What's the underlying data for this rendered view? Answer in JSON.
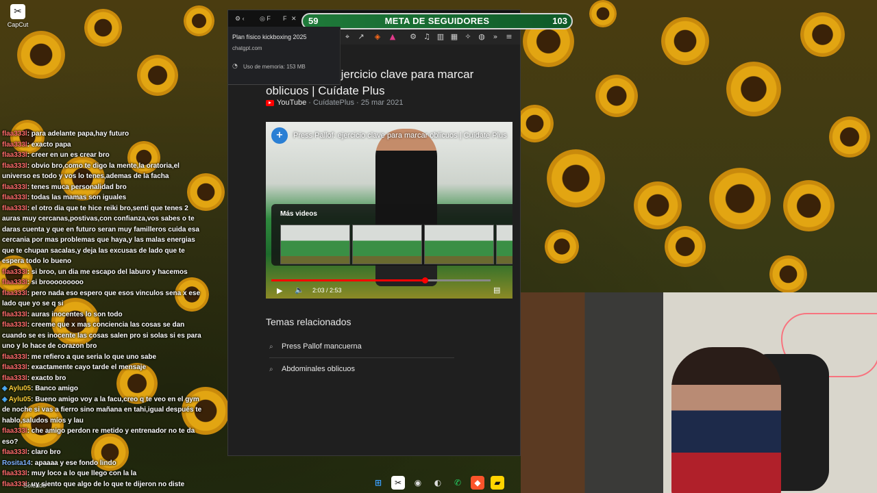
{
  "desktop": {
    "icon_label": "CapCut"
  },
  "browser": {
    "tabs": [
      "Plan físico kickboxing 2025"
    ],
    "tooltip": {
      "title": "Plan físico kickboxing 2025",
      "domain": "chatgpt.com",
      "memory": "Uso de memoria: 153 MB"
    },
    "content": {
      "title": "Press Pallof: ejercicio clave para marcar oblicuos | Cuídate Plus",
      "source": "YouTube",
      "channel": "CuídatePlus",
      "date": "25 mar 2021",
      "video_title": "Press Pallof: ejercicio clave para marcar oblicuos | Cuídate Plus",
      "more_videos": "Más videos",
      "time": "2:03 / 2:53",
      "progress": 0.7,
      "related_heading": "Temas relacionados",
      "related": [
        "Press Pallof mancuerna",
        "Abdominales oblicuos"
      ]
    }
  },
  "goal": {
    "current": "59",
    "label": "META DE SEGUIDORES",
    "target": "103"
  },
  "chat": [
    {
      "user": "flaa333l",
      "text": ": para adelante papa,hay futuro"
    },
    {
      "user": "flaa333l",
      "text": ": exacto papa"
    },
    {
      "user": "flaa333l",
      "text": ": creer en un es crear bro"
    },
    {
      "user": "flaa333l",
      "text": ": obvio bro,como te digo la mente,la oratoria,el universo es todo y vos lo tenes,ademas de la facha"
    },
    {
      "user": "flaa333l",
      "text": ": tenes muca personalidad bro"
    },
    {
      "user": "flaa333l",
      "text": ": todas las mamas son iguales"
    },
    {
      "user": "flaa333l",
      "text": ": el otro dia que te hice reiki bro,senti que tenes 2 auras muy cercanas,postivas,con confianza,vos sabes o te daras cuenta y que en futuro seran muy familleros cuida esa cercania por mas problemas que haya,y las malas energias que te chupan sacalas,y deja las excusas de lado que te espera todo lo bueno"
    },
    {
      "user": "flaa333l",
      "text": ": si broo, un dia me escapo del laburo y hacemos"
    },
    {
      "user": "flaa333l",
      "text": ": si brooooooooo"
    },
    {
      "user": "flaa333l",
      "text": ": pero nada eso espero que esos vinculos sena x ese lado que yo se q si"
    },
    {
      "user": "flaa333l",
      "text": ": auras inocentes lo son todo"
    },
    {
      "user": "flaa333l",
      "text": ": creeme que x mas conciencia las cosas se dan cuando se es inocente las cosas salen pro si solas si es para uno y lo hace de corazon bro"
    },
    {
      "user": "flaa333l",
      "text": ": me refiero a que seria lo que uno sabe"
    },
    {
      "user": "flaa333l",
      "text": ": exactamente cayo tarde el mensaje"
    },
    {
      "user": "flaa333l",
      "text": ": exacto bro"
    },
    {
      "user": "Aylu05",
      "text": ": Banco amigo",
      "badge": true
    },
    {
      "user": "Aylu05",
      "text": ": Bueno amigo voy a la facu,creo q te veo en el gym de noche si vas a fierro sino mañana en tahi,igual después te hablo,saludos míos y lau",
      "badge": true
    },
    {
      "user": "flaa333l",
      "text": ": che amigo perdon re metido y entrenador no te da eso?"
    },
    {
      "user": "flaa333l",
      "text": ": claro bro"
    },
    {
      "user": "Rosita14",
      "text": ": apaaaa y ese fondo lindo"
    },
    {
      "user": "flaa333l",
      "text": ": muy loco a lo que llego con la la"
    },
    {
      "user": "flaa333l",
      "text": ": uy siento que algo de lo que te dijeron no diste mucho y paso"
    }
  ],
  "weather": "Soleado",
  "colors": {
    "user_default": "#ff6b6b",
    "user_aylu": "#ffd23a",
    "user_rosita": "#7fb2ff",
    "goal_bg": "#1f7a3a"
  }
}
